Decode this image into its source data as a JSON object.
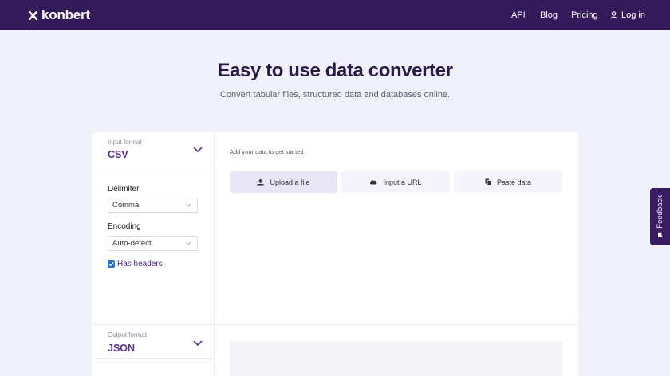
{
  "header": {
    "logo_text": "konbert",
    "logo_icon": "x-logo-icon",
    "nav": {
      "api": "API",
      "blog": "Blog",
      "pricing": "Pricing",
      "login": "Log in",
      "login_icon": "user-icon"
    }
  },
  "hero": {
    "title": "Easy to use data converter",
    "subtitle": "Convert tabular files, structured data and databases online."
  },
  "input_panel": {
    "format_label": "Input format",
    "format_value": "CSV",
    "delimiter_label": "Delimiter",
    "delimiter_value": "Comma",
    "encoding_label": "Encoding",
    "encoding_value": "Auto-detect",
    "has_headers_label": "Has headers",
    "has_headers_checked": true
  },
  "data_panel": {
    "hint": "Add your data to get started",
    "tabs": [
      {
        "label": "Upload a file",
        "icon": "upload-icon",
        "active": true
      },
      {
        "label": "Input a URL",
        "icon": "cloud-icon",
        "active": false
      },
      {
        "label": "Paste data",
        "icon": "paste-icon",
        "active": false
      }
    ]
  },
  "output_panel": {
    "format_label": "Output format",
    "format_value": "JSON"
  },
  "feedback": {
    "label": "Feedback",
    "icon": "chat-bubble-icon"
  },
  "colors": {
    "header_bg": "#331a5b",
    "page_bg": "#f0f1fb",
    "accent_purple": "#5b2f9c",
    "feedback_bg": "#3b1c63",
    "active_tab_bg": "#e7e5f6",
    "checkbox_blue": "#1a73e8"
  }
}
